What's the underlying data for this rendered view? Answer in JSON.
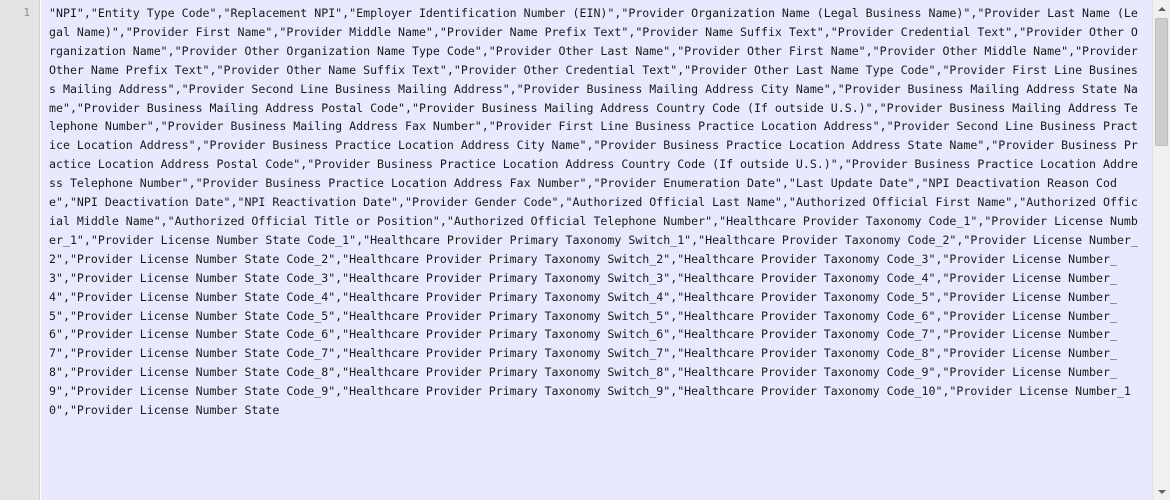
{
  "editor": {
    "line_number": "1",
    "content": "\"NPI\",\"Entity Type Code\",\"Replacement NPI\",\"Employer Identification Number (EIN)\",\"Provider Organization Name (Legal Business Name)\",\"Provider Last Name (Legal Name)\",\"Provider First Name\",\"Provider Middle Name\",\"Provider Name Prefix Text\",\"Provider Name Suffix Text\",\"Provider Credential Text\",\"Provider Other Organization Name\",\"Provider Other Organization Name Type Code\",\"Provider Other Last Name\",\"Provider Other First Name\",\"Provider Other Middle Name\",\"Provider Other Name Prefix Text\",\"Provider Other Name Suffix Text\",\"Provider Other Credential Text\",\"Provider Other Last Name Type Code\",\"Provider First Line Business Mailing Address\",\"Provider Second Line Business Mailing Address\",\"Provider Business Mailing Address City Name\",\"Provider Business Mailing Address State Name\",\"Provider Business Mailing Address Postal Code\",\"Provider Business Mailing Address Country Code (If outside U.S.)\",\"Provider Business Mailing Address Telephone Number\",\"Provider Business Mailing Address Fax Number\",\"Provider First Line Business Practice Location Address\",\"Provider Second Line Business Practice Location Address\",\"Provider Business Practice Location Address City Name\",\"Provider Business Practice Location Address State Name\",\"Provider Business Practice Location Address Postal Code\",\"Provider Business Practice Location Address Country Code (If outside U.S.)\",\"Provider Business Practice Location Address Telephone Number\",\"Provider Business Practice Location Address Fax Number\",\"Provider Enumeration Date\",\"Last Update Date\",\"NPI Deactivation Reason Code\",\"NPI Deactivation Date\",\"NPI Reactivation Date\",\"Provider Gender Code\",\"Authorized Official Last Name\",\"Authorized Official First Name\",\"Authorized Official Middle Name\",\"Authorized Official Title or Position\",\"Authorized Official Telephone Number\",\"Healthcare Provider Taxonomy Code_1\",\"Provider License Number_1\",\"Provider License Number State Code_1\",\"Healthcare Provider Primary Taxonomy Switch_1\",\"Healthcare Provider Taxonomy Code_2\",\"Provider License Number_2\",\"Provider License Number State Code_2\",\"Healthcare Provider Primary Taxonomy Switch_2\",\"Healthcare Provider Taxonomy Code_3\",\"Provider License Number_3\",\"Provider License Number State Code_3\",\"Healthcare Provider Primary Taxonomy Switch_3\",\"Healthcare Provider Taxonomy Code_4\",\"Provider License Number_4\",\"Provider License Number State Code_4\",\"Healthcare Provider Primary Taxonomy Switch_4\",\"Healthcare Provider Taxonomy Code_5\",\"Provider License Number_5\",\"Provider License Number State Code_5\",\"Healthcare Provider Primary Taxonomy Switch_5\",\"Healthcare Provider Taxonomy Code_6\",\"Provider License Number_6\",\"Provider License Number State Code_6\",\"Healthcare Provider Primary Taxonomy Switch_6\",\"Healthcare Provider Taxonomy Code_7\",\"Provider License Number_7\",\"Provider License Number State Code_7\",\"Healthcare Provider Primary Taxonomy Switch_7\",\"Healthcare Provider Taxonomy Code_8\",\"Provider License Number_8\",\"Provider License Number State Code_8\",\"Healthcare Provider Primary Taxonomy Switch_8\",\"Healthcare Provider Taxonomy Code_9\",\"Provider License Number_9\",\"Provider License Number State Code_9\",\"Healthcare Provider Primary Taxonomy Switch_9\",\"Healthcare Provider Taxonomy Code_10\",\"Provider License Number_10\",\"Provider License Number State"
  },
  "scrollbar": {
    "up_icon": "chevron-up-icon",
    "down_icon": "chevron-down-icon"
  },
  "colors": {
    "line_highlight": "#e8e8ff",
    "gutter": "#e4e4e4",
    "text": "#1a1a1a"
  }
}
